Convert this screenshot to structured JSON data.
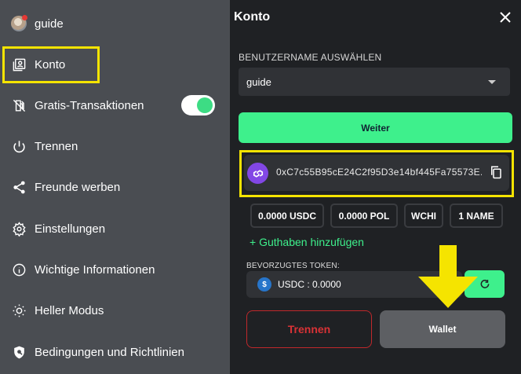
{
  "sidebar": {
    "username": "guide",
    "items": [
      {
        "label": "Konto",
        "icon": "account-icon"
      },
      {
        "label": "Gratis-Transaktionen",
        "icon": "gas-off-icon",
        "toggle_on": true
      },
      {
        "label": "Trennen",
        "icon": "power-icon"
      },
      {
        "label": "Freunde werben",
        "icon": "share-icon"
      },
      {
        "label": "Einstellungen",
        "icon": "gear-icon"
      },
      {
        "label": "Wichtige Informationen",
        "icon": "info-icon"
      },
      {
        "label": "Heller Modus",
        "icon": "sun-icon"
      },
      {
        "label": "Bedingungen und Richtlinien",
        "icon": "shield-icon"
      }
    ]
  },
  "panel": {
    "title": "Konto",
    "username_label": "BENUTZERNAME AUSWÄHLEN",
    "username_value": "guide",
    "continue_label": "Weiter",
    "address": "0xC7c55B95cE24C2f95D3e14bf445Fa75573E...",
    "balances": [
      "0.0000 USDC",
      "0.0000 POL",
      "WCHI",
      "1 NAME"
    ],
    "add_funds_label": "+ Guthaben hinzufügen",
    "preferred_token_label": "BEVORZUGTES TOKEN:",
    "preferred_token_value": "USDC : 0.0000",
    "disconnect_label": "Trennen",
    "wallet_label": "Wallet"
  },
  "colors": {
    "accent_green": "#3ef08c",
    "highlight_yellow": "#f5e400",
    "danger_red": "#d83236",
    "polygon_purple": "#8247e5",
    "usdc_blue": "#2775ca"
  }
}
